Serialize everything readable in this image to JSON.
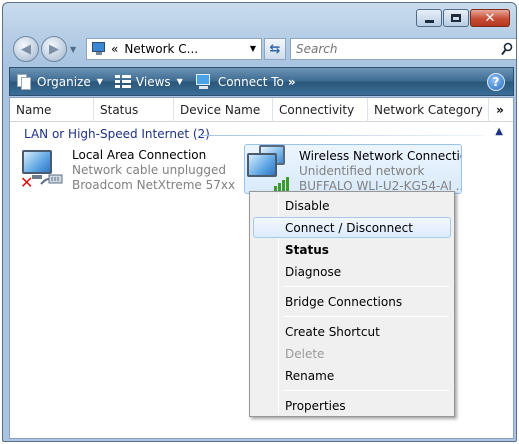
{
  "window": {
    "caption_buttons": {
      "minimize_icon": "minimize-icon",
      "maximize_icon": "maximize-icon",
      "close_glyph": "✕"
    }
  },
  "navigation": {
    "address_chevron": "«",
    "address_text": "Network C...",
    "search_placeholder": "Search"
  },
  "command_bar": {
    "organize": "Organize",
    "views": "Views",
    "connect_to": "Connect To",
    "more": "»",
    "help": "?"
  },
  "columns": [
    "Name",
    "Status",
    "Device Name",
    "Connectivity",
    "Network Category"
  ],
  "columns_more": "»",
  "group": {
    "label": "LAN or High-Speed Internet (2)"
  },
  "items": [
    {
      "name": "Local Area Connection",
      "status": "Network cable unplugged",
      "device": "Broadcom NetXtreme 57xx ..."
    },
    {
      "name": "Wireless Network Connection",
      "status": "Unidentified network",
      "device": "BUFFALO WLI-U2-KG54-AI ..."
    }
  ],
  "context_menu": {
    "items": [
      {
        "label": "Disable"
      },
      {
        "label": "Connect / Disconnect",
        "highlighted": true
      },
      {
        "label": "Status",
        "default": true
      },
      {
        "label": "Diagnose"
      },
      {
        "label": "Bridge Connections"
      },
      {
        "label": "Create Shortcut"
      },
      {
        "label": "Delete",
        "disabled": true
      },
      {
        "label": "Rename"
      },
      {
        "label": "Properties"
      }
    ]
  },
  "colors": {
    "group_text": "#1e3287",
    "selection_border": "#99c3ec",
    "close_button": "#c74c35"
  }
}
